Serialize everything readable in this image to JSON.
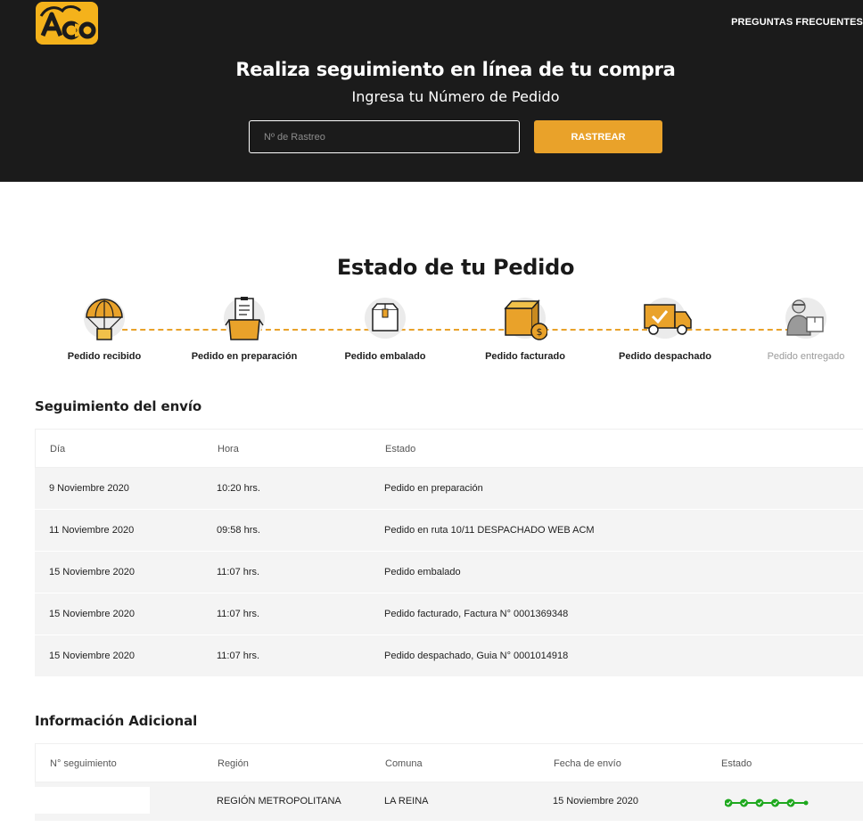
{
  "header": {
    "logo_text": "ACO",
    "nav_link": "PREGUNTAS FRECUENTES",
    "title": "Realiza seguimiento en línea de tu compra",
    "subtitle": "Ingresa tu Número de Pedido",
    "input_placeholder": "Nº de Rastreo",
    "button_label": "RASTREAR"
  },
  "status": {
    "title": "Estado de tu Pedido",
    "steps": [
      {
        "label": "Pedido recibido",
        "icon": "parachute-box-icon",
        "done": true
      },
      {
        "label": "Pedido en preparación",
        "icon": "clipboard-box-icon",
        "done": true
      },
      {
        "label": "Pedido embalado",
        "icon": "box-icon",
        "done": true
      },
      {
        "label": "Pedido facturado",
        "icon": "box-coins-icon",
        "done": true
      },
      {
        "label": "Pedido despachado",
        "icon": "truck-check-icon",
        "done": true
      },
      {
        "label": "Pedido entregado",
        "icon": "delivery-person-icon",
        "done": false
      }
    ]
  },
  "tracking": {
    "title": "Seguimiento del envío",
    "headers": [
      "Día",
      "Hora",
      "Estado"
    ],
    "rows": [
      {
        "day": "9 Noviembre 2020",
        "time": "10:20 hrs.",
        "status": "Pedido en preparación"
      },
      {
        "day": "11 Noviembre 2020",
        "time": "09:58 hrs.",
        "status": "Pedido en ruta 10/11 DESPACHADO WEB ACM"
      },
      {
        "day": "15 Noviembre 2020",
        "time": "11:07 hrs.",
        "status": "Pedido embalado"
      },
      {
        "day": "15 Noviembre 2020",
        "time": "11:07 hrs.",
        "status": "Pedido facturado, Factura N° 0001369348"
      },
      {
        "day": "15 Noviembre 2020",
        "time": "11:07 hrs.",
        "status": "Pedido despachado, Guia N° 0001014918"
      }
    ]
  },
  "info": {
    "title": "Información Adicional",
    "headers": [
      "N° seguimiento",
      "Región",
      "Comuna",
      "Fecha de envío",
      "Estado"
    ],
    "row": {
      "tracking_number": "",
      "region": "REGIÓN METROPOLITANA",
      "comuna": "LA REINA",
      "date": "15 Noviembre 2020",
      "progress_done": 5,
      "progress_total": 6
    }
  },
  "colors": {
    "accent": "#e9a22a",
    "logo": "#f4b21b",
    "header_bg": "#1b1b1b",
    "progress": "#1ea81e",
    "row_bg": "#f4f4f4"
  }
}
